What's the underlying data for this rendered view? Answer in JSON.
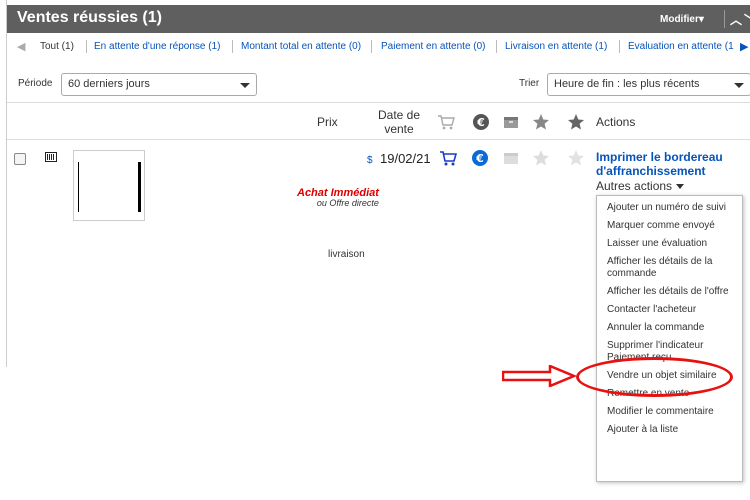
{
  "header": {
    "title": "Ventes réussies (1)",
    "modifier": "Modifier",
    "collapse_glyph": "⌃⌄"
  },
  "tabs": [
    {
      "label": "Tout (1)"
    },
    {
      "label": "En attente d'une réponse (1)"
    },
    {
      "label": "Montant total en attente (0)"
    },
    {
      "label": "Paiement en attente (0)"
    },
    {
      "label": "Livraison en attente (1)"
    },
    {
      "label": "Évaluation en attente (1"
    }
  ],
  "filters": {
    "periode_label": "Période",
    "periode_value": "60 derniers jours",
    "trier_label": "Trier",
    "trier_value": "Heure de fin : les plus récents"
  },
  "columns": {
    "prix": "Prix",
    "date_line1": "Date de",
    "date_line2": "vente",
    "actions": "Actions"
  },
  "icons": [
    "cart-icon",
    "euro-icon",
    "package-icon",
    "star-icon",
    "star-badge-icon"
  ],
  "row": {
    "price_fragment": "$",
    "achat_line1": "Achat Immédiat",
    "achat_line2": "ou Offre directe",
    "livraison": "livraison",
    "date": "19/02/21",
    "action_link": "Imprimer le bordereau d'affranchissement",
    "autres_actions": "Autres actions"
  },
  "menu": {
    "items": [
      "Ajouter un numéro de suivi",
      "Marquer comme envoyé",
      "Laisser une évaluation",
      "Afficher les détails de la commande",
      "Afficher les détails de l'offre",
      "Contacter l'acheteur",
      "Annuler la commande",
      "Supprimer l'indicateur Paiement reçu",
      "Vendre un objet similaire",
      "Remettre en vente",
      "Modifier le commentaire",
      "Ajouter à la liste"
    ]
  },
  "colors": {
    "header_bg": "#5f5f5f",
    "link_blue": "#0654ba",
    "annotation_red": "#e81010"
  }
}
